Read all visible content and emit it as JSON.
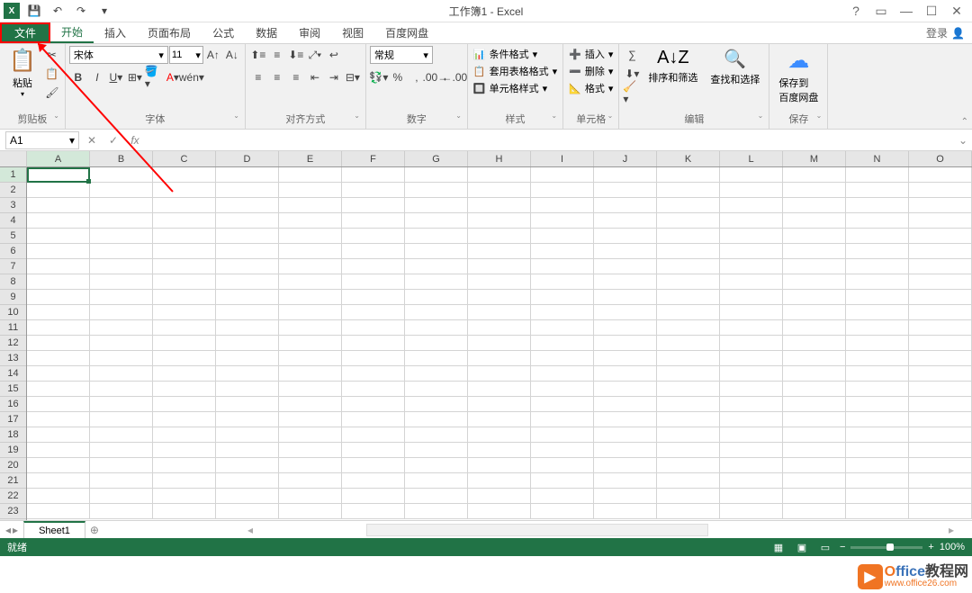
{
  "title": "工作簿1 - Excel",
  "qat": {
    "save": "💾",
    "undo": "↶",
    "redo": "↷"
  },
  "tabs": {
    "file": "文件",
    "items": [
      "开始",
      "插入",
      "页面布局",
      "公式",
      "数据",
      "审阅",
      "视图",
      "百度网盘"
    ],
    "active": "开始",
    "login": "登录"
  },
  "ribbon": {
    "clipboard": {
      "label": "剪贴板",
      "paste": "粘贴",
      "cut": "✂",
      "copy": "📋",
      "painter": "🖌"
    },
    "font": {
      "label": "字体",
      "name": "宋体",
      "size": "11"
    },
    "alignment": {
      "label": "对齐方式"
    },
    "number": {
      "label": "数字",
      "format": "常规"
    },
    "styles": {
      "label": "样式",
      "cond": "条件格式",
      "table": "套用表格格式",
      "cell": "单元格样式"
    },
    "cells": {
      "label": "单元格",
      "insert": "插入",
      "delete": "删除",
      "format": "格式"
    },
    "editing": {
      "label": "编辑",
      "sum": "∑",
      "sort": "排序和筛选",
      "find": "查找和选择"
    },
    "save": {
      "label": "保存",
      "baidu": "保存到\n百度网盘"
    }
  },
  "formula_bar": {
    "name_box": "A1"
  },
  "grid": {
    "cols": [
      "A",
      "B",
      "C",
      "D",
      "E",
      "F",
      "G",
      "H",
      "I",
      "J",
      "K",
      "L",
      "M",
      "N",
      "O"
    ],
    "rows": [
      1,
      2,
      3,
      4,
      5,
      6,
      7,
      8,
      9,
      10,
      11,
      12,
      13,
      14,
      15,
      16,
      17,
      18,
      19,
      20,
      21,
      22,
      23
    ],
    "active": "A1"
  },
  "sheets": {
    "active": "Sheet1"
  },
  "status": {
    "ready": "就绪",
    "zoom": "100%"
  },
  "watermark": {
    "main_prefix": "O",
    "main_mid": "ffice",
    "main_suffix": "教程网",
    "sub": "www.office26.com"
  }
}
